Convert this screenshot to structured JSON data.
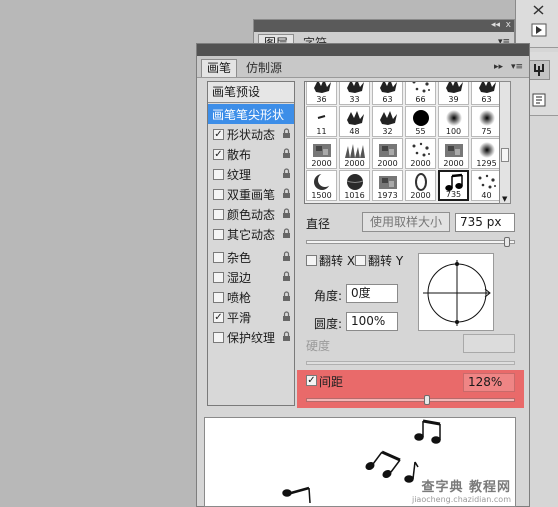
{
  "back_panel": {
    "tabs": [
      {
        "label": "图层",
        "active": true
      },
      {
        "label": "字符",
        "active": false
      }
    ]
  },
  "brush_panel": {
    "tabs": [
      {
        "label": "画笔",
        "active": true
      },
      {
        "label": "仿制源",
        "active": false
      }
    ],
    "preset_button": "画笔预设",
    "options": [
      {
        "label": "画笔笔尖形状",
        "checkbox": false,
        "checked": false,
        "selected": true,
        "lock": false
      },
      {
        "label": "形状动态",
        "checkbox": true,
        "checked": true,
        "selected": false,
        "lock": true
      },
      {
        "label": "散布",
        "checkbox": true,
        "checked": true,
        "selected": false,
        "lock": true
      },
      {
        "label": "纹理",
        "checkbox": true,
        "checked": false,
        "selected": false,
        "lock": true
      },
      {
        "label": "双重画笔",
        "checkbox": true,
        "checked": false,
        "selected": false,
        "lock": true
      },
      {
        "label": "颜色动态",
        "checkbox": true,
        "checked": false,
        "selected": false,
        "lock": true
      },
      {
        "label": "其它动态",
        "checkbox": true,
        "checked": false,
        "selected": false,
        "lock": true
      },
      {
        "label": "杂色",
        "checkbox": true,
        "checked": false,
        "selected": false,
        "lock": true
      },
      {
        "label": "湿边",
        "checkbox": true,
        "checked": false,
        "selected": false,
        "lock": true
      },
      {
        "label": "喷枪",
        "checkbox": true,
        "checked": false,
        "selected": false,
        "lock": true
      },
      {
        "label": "平滑",
        "checkbox": true,
        "checked": true,
        "selected": false,
        "lock": true
      },
      {
        "label": "保护纹理",
        "checkbox": true,
        "checked": false,
        "selected": false,
        "lock": true
      }
    ],
    "brush_tips": [
      {
        "num": "36",
        "shape": "splat"
      },
      {
        "num": "33",
        "shape": "splat"
      },
      {
        "num": "63",
        "shape": "splat"
      },
      {
        "num": "66",
        "shape": "scatter"
      },
      {
        "num": "39",
        "shape": "splat"
      },
      {
        "num": "63",
        "shape": "splat"
      },
      {
        "num": "11",
        "shape": "dash"
      },
      {
        "num": "48",
        "shape": "splat"
      },
      {
        "num": "32",
        "shape": "splat"
      },
      {
        "num": "55",
        "shape": "solid"
      },
      {
        "num": "100",
        "shape": "soft"
      },
      {
        "num": "75",
        "shape": "soft"
      },
      {
        "num": "2000",
        "shape": "texture"
      },
      {
        "num": "2000",
        "shape": "grass"
      },
      {
        "num": "2000",
        "shape": "texture"
      },
      {
        "num": "2000",
        "shape": "scatter"
      },
      {
        "num": "2000",
        "shape": "texture"
      },
      {
        "num": "1295",
        "shape": "soft"
      },
      {
        "num": "1500",
        "shape": "moon"
      },
      {
        "num": "1016",
        "shape": "planet"
      },
      {
        "num": "1973",
        "shape": "texture"
      },
      {
        "num": "2000",
        "shape": "ring"
      },
      {
        "num": "735",
        "shape": "note",
        "selected": true
      },
      {
        "num": "40",
        "shape": "scatter"
      }
    ],
    "diameter_label": "直径",
    "use_sample_size_button": "使用取样大小",
    "diameter_value": "735 px",
    "diameter_slider": 0.96,
    "flip_x_label": "翻转 X",
    "flip_y_label": "翻转 Y",
    "angle_label": "角度:",
    "angle_value": "0度",
    "roundness_label": "圆度:",
    "roundness_value": "100%",
    "hardness_label": "硬度",
    "spacing_label": "间距",
    "spacing_checked": true,
    "spacing_value": "128%",
    "spacing_slider": 0.58
  },
  "watermark": {
    "line1": "查字典 教程网",
    "line2": "jiaocheng.chazidian.com"
  },
  "colors": {
    "highlight": "#e96a6a",
    "selection": "#3d8ee8"
  },
  "icons": [
    "scissors-icon",
    "play-icon",
    "brush-icon",
    "brush-preset-icon",
    "collapse-arrows-icon",
    "panel-menu-icon",
    "lock-icon"
  ]
}
